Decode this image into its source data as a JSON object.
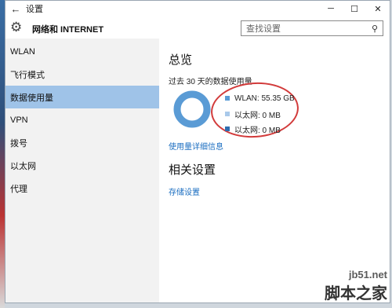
{
  "window": {
    "title": "设置"
  },
  "header": {
    "app_name": "网络和 INTERNET",
    "search_placeholder": "查找设置"
  },
  "sidebar": {
    "items": [
      {
        "label": "WLAN"
      },
      {
        "label": "飞行模式"
      },
      {
        "label": "数据使用量",
        "selected": true
      },
      {
        "label": "VPN"
      },
      {
        "label": "拨号"
      },
      {
        "label": "以太网"
      },
      {
        "label": "代理"
      }
    ]
  },
  "content": {
    "overview_title": "总览",
    "usage_subtitle": "过去 30 天的数据使用量",
    "legend": [
      {
        "label": "WLAN: 55.35 GB",
        "color": "#5a9bd5"
      },
      {
        "label": "以太网: 0 MB",
        "color": "#a9c9ea"
      },
      {
        "label": "以太网: 0 MB",
        "color": "#2f6eb0"
      }
    ],
    "usage_details_link": "使用量详细信息",
    "related_title": "相关设置",
    "storage_link": "存储设置"
  },
  "watermark": {
    "site": "jb51.net",
    "brand": "脚本之家"
  }
}
